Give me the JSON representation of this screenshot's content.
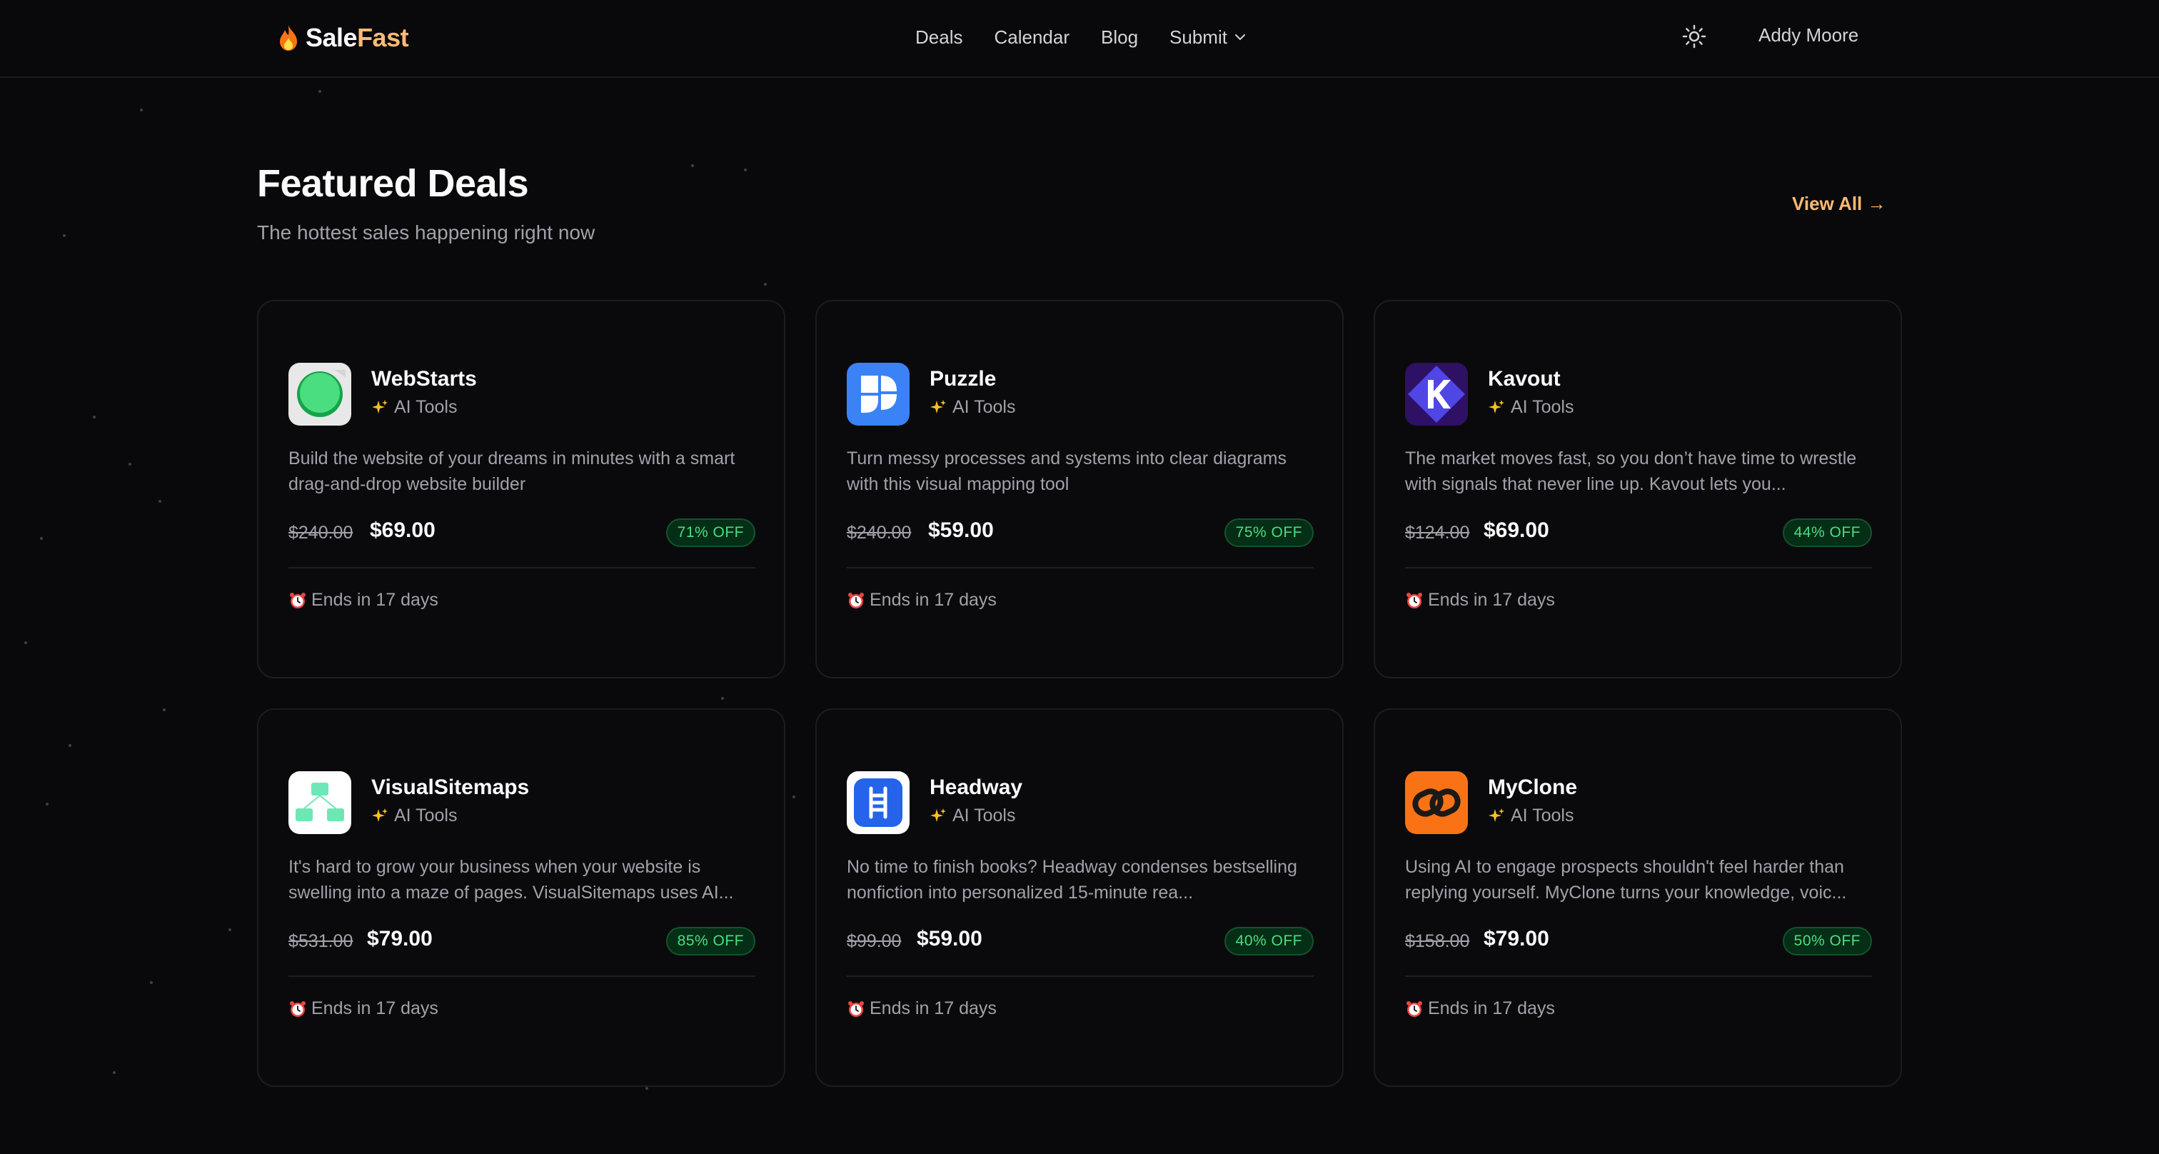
{
  "header": {
    "brand_part1": "Sale",
    "brand_part2": "Fast",
    "nav": [
      {
        "label": "Deals"
      },
      {
        "label": "Calendar"
      },
      {
        "label": "Blog"
      },
      {
        "label": "Submit"
      }
    ],
    "user_name": "Addy Moore"
  },
  "featured": {
    "title": "Featured Deals",
    "subtitle": "The hottest sales happening right now",
    "view_all": "View All →"
  },
  "deals": [
    {
      "name": "WebStarts",
      "category": "AI Tools",
      "description": "Build the website of your dreams in minutes with a smart drag-and-drop website builder",
      "old_price": "$240.00",
      "new_price": "$69.00",
      "discount": "71% OFF",
      "ends": "Ends in 17 days",
      "icon": "webstarts-logo-icon"
    },
    {
      "name": "Puzzle",
      "category": "AI Tools",
      "description": "Turn messy processes and systems into clear diagrams with this visual mapping tool",
      "old_price": "$240.00",
      "new_price": "$59.00",
      "discount": "75% OFF",
      "ends": "Ends in 17 days",
      "icon": "puzzle-logo-icon"
    },
    {
      "name": "Kavout",
      "category": "AI Tools",
      "description": "The market moves fast, so you don’t have time to wrestle with signals that never line up. Kavout lets you...",
      "old_price": "$124.00",
      "new_price": "$69.00",
      "discount": "44% OFF",
      "ends": "Ends in 17 days",
      "icon": "kavout-logo-icon"
    },
    {
      "name": "VisualSitemaps",
      "category": "AI Tools",
      "description": "It's hard to grow your business when your website is swelling into a maze of pages. VisualSitemaps uses AI...",
      "old_price": "$531.00",
      "new_price": "$79.00",
      "discount": "85% OFF",
      "ends": "Ends in 17 days",
      "icon": "visualsitemaps-logo-icon"
    },
    {
      "name": "Headway",
      "category": "AI Tools",
      "description": "No time to finish books? Headway condenses bestselling nonfiction into personalized 15-minute rea...",
      "old_price": "$99.00",
      "new_price": "$59.00",
      "discount": "40% OFF",
      "ends": "Ends in 17 days",
      "icon": "headway-logo-icon"
    },
    {
      "name": "MyClone",
      "category": "AI Tools",
      "description": "Using AI to engage prospects shouldn't feel harder than replying yourself. MyClone turns your knowledge, voic...",
      "old_price": "$158.00",
      "new_price": "$79.00",
      "discount": "50% OFF",
      "ends": "Ends in 17 days",
      "icon": "myclone-logo-icon"
    }
  ],
  "colors": {
    "background": "#09090b",
    "accent": "#fdba74",
    "discount_text": "#4ade80",
    "muted_text": "#a1a1aa"
  }
}
